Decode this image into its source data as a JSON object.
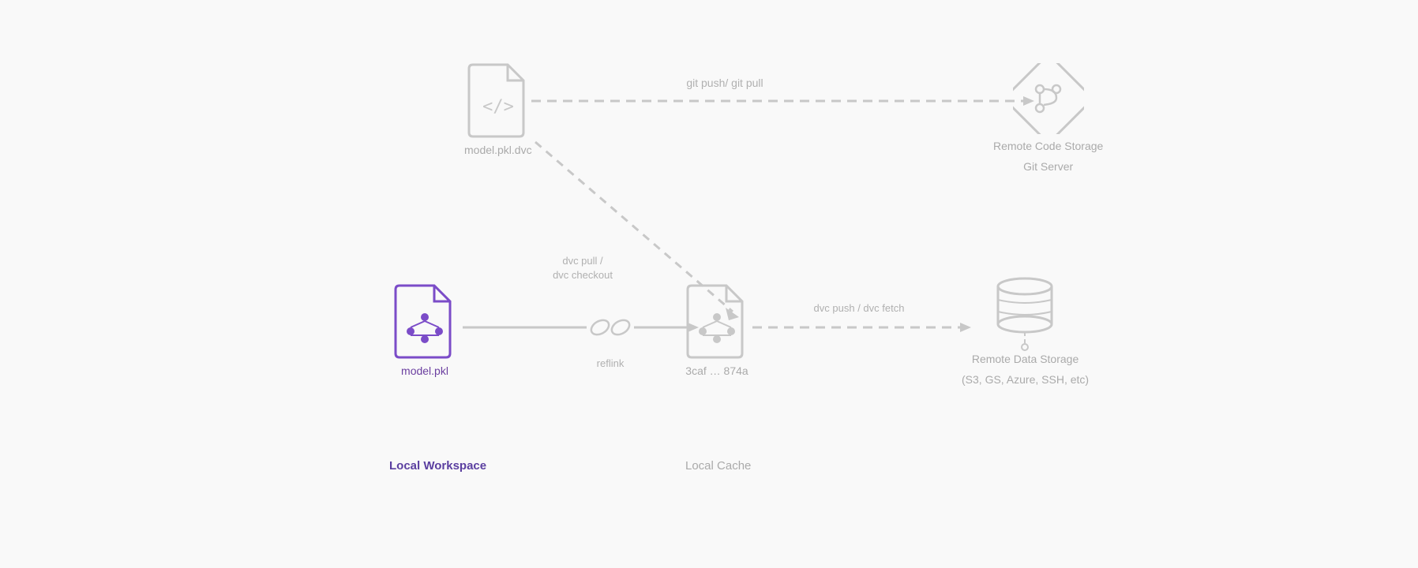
{
  "nodes": {
    "dvc_file": {
      "label": "model.pkl.dvc",
      "color_gray": "#c8c8c8"
    },
    "git_server": {
      "label_line1": "Remote Code Storage",
      "label_line2": "Git Server",
      "color_gray": "#c8c8c8"
    },
    "pkl_file": {
      "label": "model.pkl",
      "color_purple": "#7b4cc8"
    },
    "cache_file": {
      "label": "3caf … 874a",
      "color_gray": "#c8c8c8"
    },
    "data_store": {
      "label_line1": "Remote Data Storage",
      "label_line2": "(S3, GS, Azure, SSH, etc)",
      "color_gray": "#c8c8c8"
    }
  },
  "arrows": {
    "git_push_pull": "git push/ git pull",
    "dvc_pull": "dvc pull /",
    "dvc_checkout": "dvc checkout",
    "reflink": "reflink",
    "dvc_push_fetch": "dvc push / dvc fetch"
  },
  "section_labels": {
    "local_workspace": "Local Workspace",
    "local_cache": "Local Cache",
    "remote_data": "Remote Data Storage\n(S3, GS, Azure, SSH, etc)"
  },
  "colors": {
    "gray": "#c8c8c8",
    "purple": "#7b4cc8",
    "blue_label": "#5b3fa0",
    "text_label": "#aaaaaa"
  }
}
